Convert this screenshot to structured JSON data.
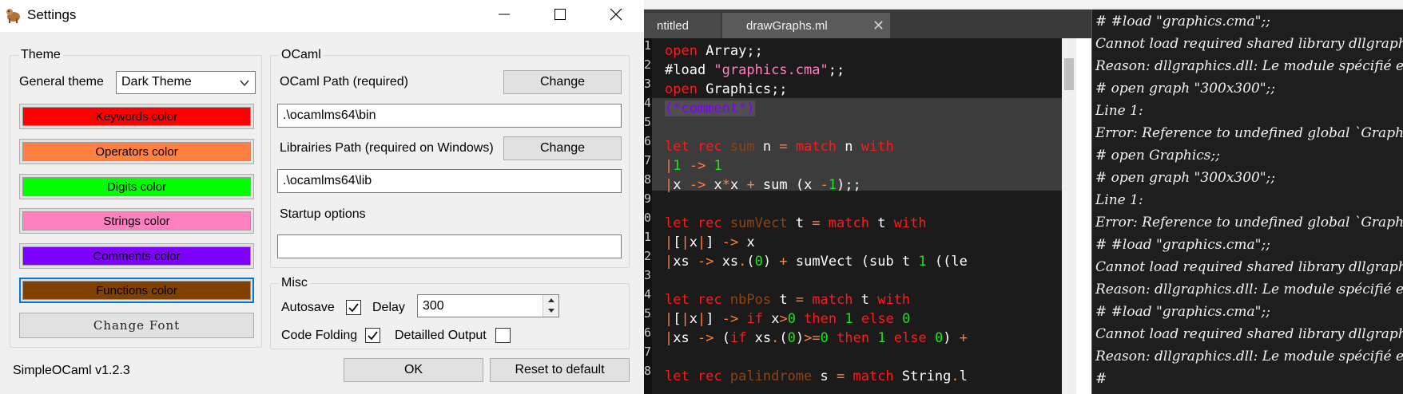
{
  "dialog": {
    "title": "Settings",
    "version": "SimpleOCaml v1.2.3",
    "ok_label": "OK",
    "reset_label": "Reset to default"
  },
  "theme": {
    "legend": "Theme",
    "general_theme_label": "General theme",
    "selected_theme": "Dark Theme",
    "keywords_label": "Keywords color",
    "operators_label": "Operators color",
    "digits_label": "Digits color",
    "strings_label": "Strings color",
    "comments_label": "Comments color",
    "functions_label": "Functions color",
    "font_label": "Change Font",
    "colors": {
      "keywords": "#ff0000",
      "operators": "#ff8040",
      "digits": "#00ff00",
      "strings": "#ff80c0",
      "comments": "#8000ff",
      "functions": "#804000"
    }
  },
  "ocaml": {
    "legend": "OCaml",
    "path_label": "OCaml Path (required)",
    "path_change": "Change",
    "path_value": ".\\ocamlms64\\bin",
    "libs_label": "Librairies Path (required on Windows)",
    "libs_change": "Change",
    "libs_value": ".\\ocamlms64\\lib",
    "startup_label": "Startup options",
    "startup_value": ""
  },
  "misc": {
    "legend": "Misc",
    "autosave_label": "Autosave",
    "autosave_checked": true,
    "delay_label": "Delay",
    "delay_value": "300",
    "folding_label": "Code Folding",
    "folding_checked": true,
    "detailed_label": "Detailled Output",
    "detailed_checked": false
  },
  "editor": {
    "tabs": [
      {
        "label": "ntitled"
      },
      {
        "label": "drawGraphs.ml"
      }
    ],
    "line_numbers": [
      "1",
      "2",
      "3",
      "4",
      "5",
      "6",
      "7",
      "8",
      "9",
      "0",
      "1",
      "2",
      "3",
      "4",
      "5",
      "6",
      "7",
      "8"
    ],
    "toplevel_lines": [
      "# #load \"graphics.cma\";;",
      "Cannot load required shared library dllgraph",
      "Reason: dllgraphics.dll: Le module spécifié es",
      "# open graph \"300x300\";;",
      "Line 1:",
      "Error: Reference to undefined global `Graph",
      "# open Graphics;;",
      "# open graph \"300x300\";;",
      "Line 1:",
      "Error: Reference to undefined global `Graph",
      "# #load \"graphics.cma\";;",
      "Cannot load required shared library dllgraph",
      "Reason: dllgraphics.dll: Le module spécifié es",
      "# #load \"graphics.cma\";;",
      "Cannot load required shared library dllgraph",
      "Reason: dllgraphics.dll: Le module spécifié es",
      "#"
    ]
  }
}
